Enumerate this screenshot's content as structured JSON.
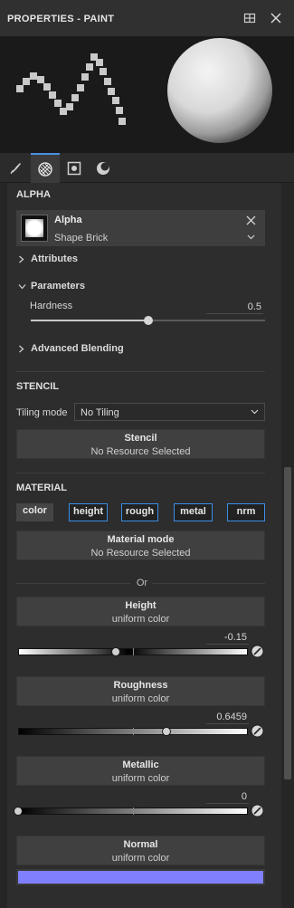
{
  "window": {
    "title": "PROPERTIES - PAINT"
  },
  "icons": {
    "maximize": "maximize-icon",
    "close": "close-icon",
    "tabs": [
      "brush-icon",
      "texture-icon",
      "mask-icon",
      "material-sphere-icon"
    ]
  },
  "alpha": {
    "section_title": "ALPHA",
    "name": "Alpha",
    "shape": "Shape Brick",
    "attributes_label": "Attributes",
    "parameters_label": "Parameters",
    "hardness_label": "Hardness",
    "hardness_value": "0.5",
    "hardness_fraction": 0.5,
    "advanced_label": "Advanced Blending"
  },
  "stencil": {
    "section_title": "STENCIL",
    "tiling_label": "Tiling mode",
    "tiling_value": "No Tiling",
    "box_title": "Stencil",
    "box_sub": "No Resource Selected"
  },
  "material": {
    "section_title": "MATERIAL",
    "channels": [
      "color",
      "height",
      "rough",
      "metal",
      "nrm"
    ],
    "mode_title": "Material mode",
    "mode_sub": "No Resource Selected",
    "or_label": "Or",
    "height": {
      "title": "Height",
      "sub": "uniform color",
      "value": "-0.15",
      "fraction": 0.425
    },
    "roughness": {
      "title": "Roughness",
      "sub": "uniform color",
      "value": "0.6459",
      "fraction": 0.6459
    },
    "metallic": {
      "title": "Metallic",
      "sub": "uniform color",
      "value": "0",
      "fraction": 0.0
    },
    "normal": {
      "title": "Normal",
      "sub": "uniform color",
      "color": "#8080ff"
    }
  },
  "colors": {
    "accent": "#4a90e2",
    "channel_border": "#3a8ee6"
  }
}
